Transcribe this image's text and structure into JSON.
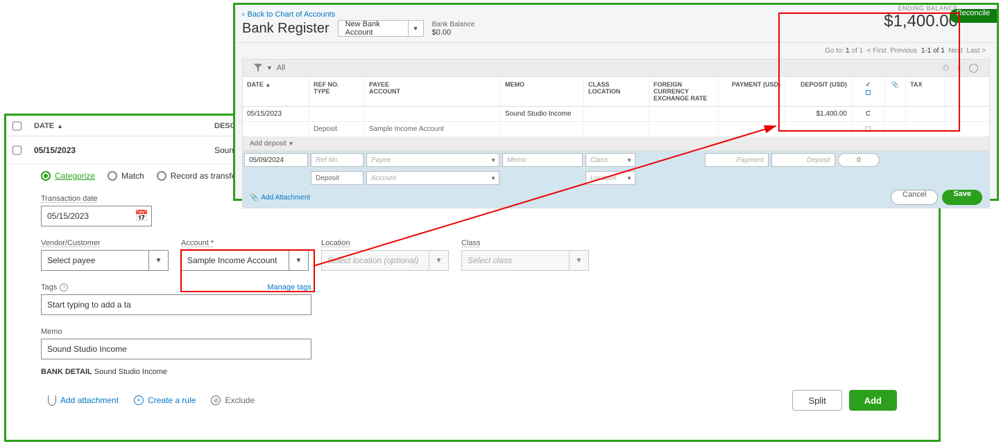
{
  "back": {
    "header": {
      "date": "DATE",
      "desc": "DESC"
    },
    "row": {
      "date": "05/15/2023",
      "desc": "Soun"
    },
    "radios": {
      "categorize": "Categorize",
      "match": "Match",
      "record_transfer": "Record as transfer"
    },
    "tx_date": {
      "label": "Transaction date",
      "value": "05/15/2023"
    },
    "vendor": {
      "label": "Vendor/Customer",
      "placeholder": "Select payee"
    },
    "account": {
      "label": "Account",
      "value": "Sample Income Account"
    },
    "location": {
      "label": "Location",
      "placeholder": "Select location (optional)"
    },
    "klass": {
      "label": "Class",
      "placeholder": "Select class"
    },
    "tags": {
      "label": "Tags",
      "manage": "Manage tags",
      "placeholder": "Start typing to add a ta"
    },
    "memo": {
      "label": "Memo",
      "value": "Sound Studio Income"
    },
    "bank_detail": {
      "label": "BANK DETAIL",
      "value": "Sound Studio Income"
    },
    "links": {
      "add_attachment": "Add attachment",
      "create_rule": "Create a rule",
      "exclude": "Exclude"
    },
    "buttons": {
      "split": "Split",
      "add": "Add"
    }
  },
  "front": {
    "back_link": "Back to Chart of Accounts",
    "title": "Bank Register",
    "account_select": "New Bank Account",
    "bank_balance_label": "Bank Balance",
    "bank_balance_value": "$0.00",
    "ending_label": "ENDING BALANCE",
    "ending_value": "$1,400.00",
    "reconcile": "Reconcile",
    "goto": {
      "pre": "Go to:",
      "page": "1",
      "of": "of 1",
      "first": "< First",
      "prev": "Previous",
      "range": "1-1 of 1",
      "next": "Next",
      "last": "Last >"
    },
    "filter_all": "All",
    "columns": {
      "date": "DATE",
      "ref": "REF NO.",
      "type": "TYPE",
      "payee": "PAYEE",
      "account": "ACCOUNT",
      "memo": "MEMO",
      "class": "CLASS",
      "location": "LOCATION",
      "fx1": "FOREIGN CURRENCY",
      "fx2": "EXCHANGE RATE",
      "payment": "PAYMENT (USD)",
      "deposit": "DEPOSIT (USD)",
      "chk": "✓",
      "att": "📎",
      "tax": "TAX"
    },
    "row1": {
      "date": "05/15/2023",
      "memo": "Sound Studio Income",
      "deposit": "$1,400.00",
      "recon": "C"
    },
    "row2": {
      "type": "Deposit",
      "account": "Sample Income Account"
    },
    "add_deposit": "Add deposit",
    "edit": {
      "date": "05/09/2024",
      "ref": "Ref No.",
      "payee": "Payee",
      "memo": "Memo",
      "class": "Class",
      "payment": "Payment",
      "deposit": "Deposit",
      "zero": "0",
      "type": "Deposit",
      "account": "Account",
      "location": "Location"
    },
    "add_attachment": "Add Attachment",
    "cancel": "Cancel",
    "save": "Save"
  }
}
